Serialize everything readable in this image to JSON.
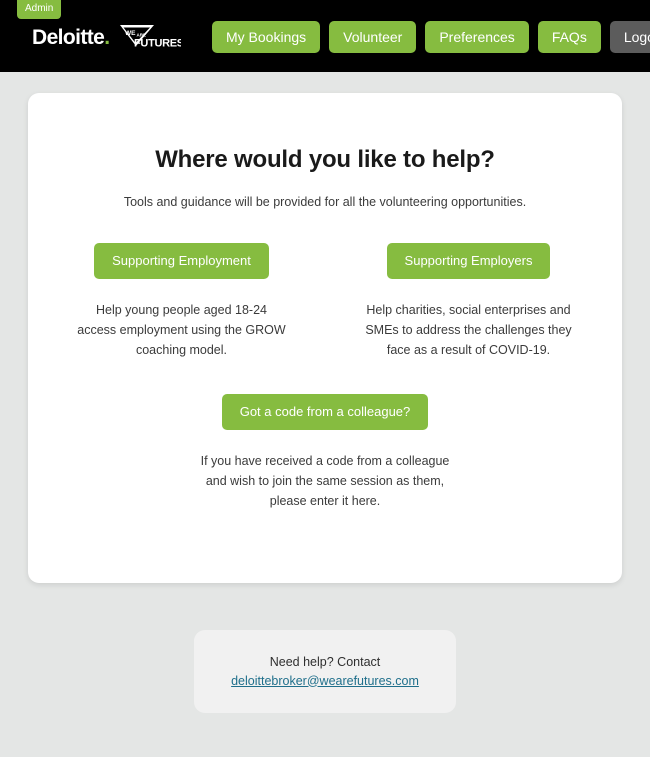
{
  "header": {
    "admin_badge": "Admin",
    "brand": {
      "deloitte": "Deloitte",
      "dot": ".",
      "partner_line1": "WE ARE",
      "partner_line2": "FUTURES"
    },
    "nav": [
      {
        "label": "My Bookings",
        "style": "primary"
      },
      {
        "label": "Volunteer",
        "style": "primary"
      },
      {
        "label": "Preferences",
        "style": "primary"
      },
      {
        "label": "FAQs",
        "style": "primary"
      },
      {
        "label": "Logout",
        "style": "secondary"
      }
    ]
  },
  "main": {
    "title": "Where would you like to help?",
    "subtitle": "Tools and guidance will be provided for all the volunteering opportunities.",
    "options": [
      {
        "button_label": "Supporting Employment",
        "description": "Help young people aged 18-24 access employment using the GROW coaching model."
      },
      {
        "button_label": "Supporting Employers",
        "description": "Help charities, social enterprises and SMEs to address the challenges they face as a result of COVID-19."
      }
    ],
    "code_section": {
      "button_label": "Got a code from a colleague?",
      "description": "If you have received a code from a colleague and wish to join the same session as them, please enter it here."
    }
  },
  "footer": {
    "contact_label": "Need help? Contact",
    "contact_email": "deloittebroker@wearefutures.com"
  },
  "colors": {
    "brand_green": "#86bc40",
    "header_black": "#000000",
    "logout_gray": "#5c5c5c",
    "page_background": "#e4e6e5",
    "card_white": "#ffffff",
    "contact_box": "#f1f1f1",
    "link_blue": "#1f6f8b",
    "body_text": "#3b3b3b"
  }
}
